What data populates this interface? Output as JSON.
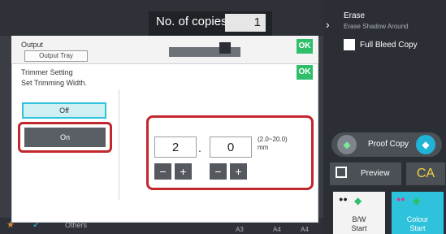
{
  "header": {
    "copies_label": "No. of copies",
    "copies_value": "1"
  },
  "right_panel": {
    "erase_title": "Erase",
    "erase_subtitle": "Erase Shadow Around",
    "full_bleed_label": "Full Bleed Copy",
    "proof_copy_label": "Proof Copy",
    "preview_label": "Preview",
    "ca_label": "CA",
    "bw_start_label": "B/W\nStart",
    "colour_start_label": "Colour\nStart"
  },
  "bottom_bar": {
    "others_label": "Others",
    "a3_label": "A3",
    "a4_label_1": "A4",
    "a4_label_2": "A4"
  },
  "output_dialog": {
    "title": "Output",
    "tray_label": "Output Tray",
    "ok_label": "OK"
  },
  "trimmer_dialog": {
    "title": "Trimmer Setting",
    "subtitle": "Set Trimming Width.",
    "ok_label": "OK",
    "off_label": "Off",
    "on_label": "On",
    "width_integer": "2",
    "separator": ".",
    "width_decimal": "0",
    "range_text": "(2.0~20.0)\nmm",
    "minus": "−",
    "plus": "+"
  },
  "colors": {
    "accent_green": "#2fbf6a",
    "accent_cyan": "#2ec2dc",
    "highlight_red": "#c2272d"
  },
  "icons": [
    "chevron-right-icon",
    "checkbox-icon",
    "diamond-icon",
    "preview-icon",
    "star-icon",
    "check-icon"
  ]
}
